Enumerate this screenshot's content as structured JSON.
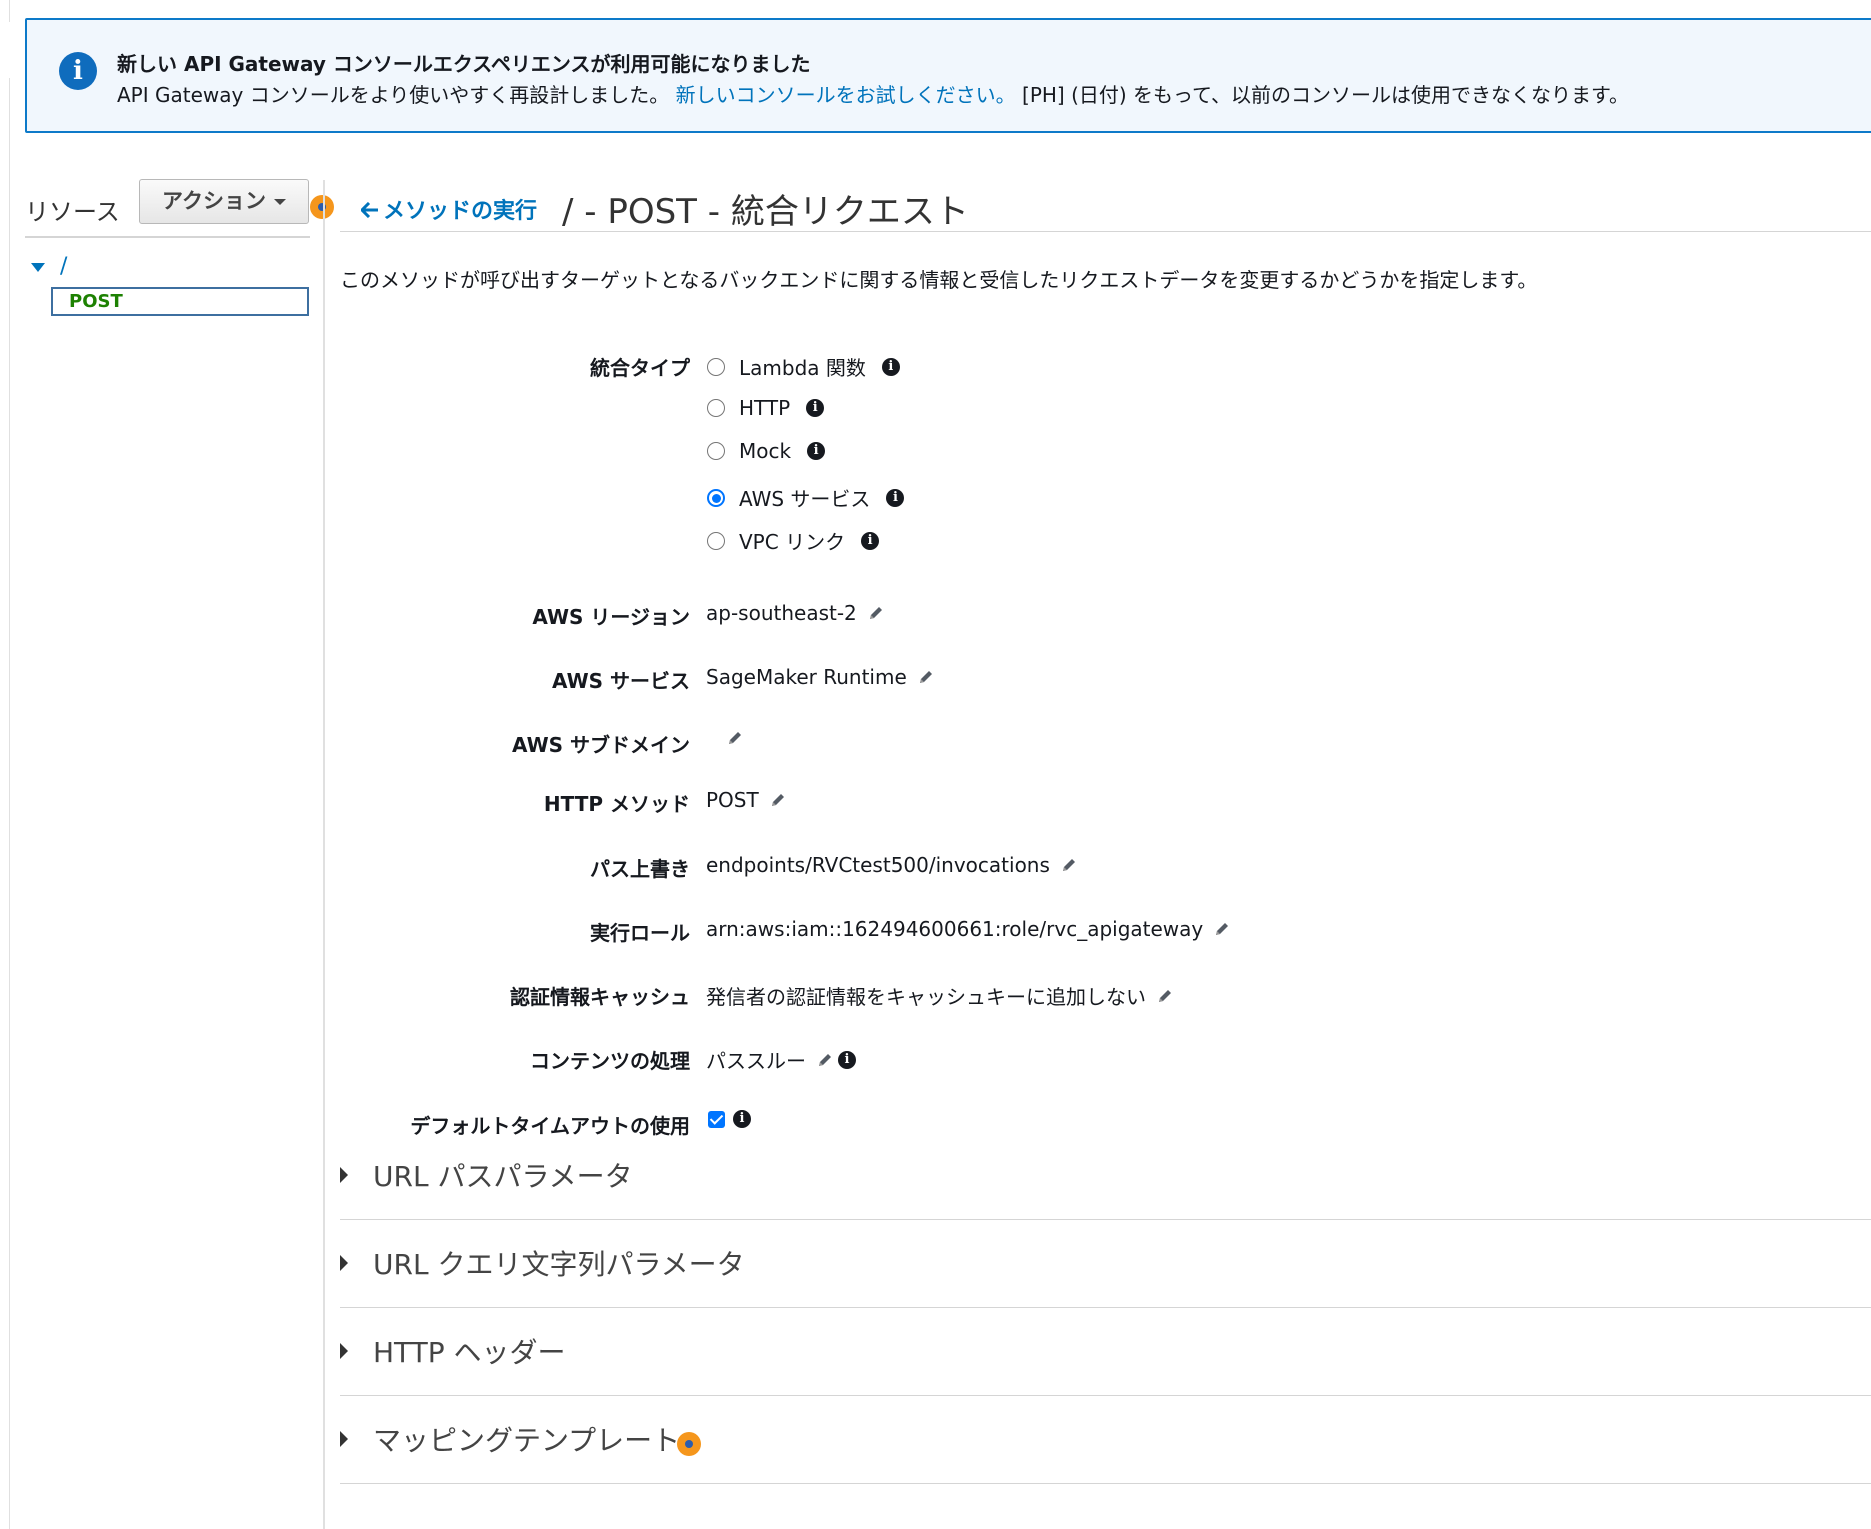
{
  "banner": {
    "icon": "info-icon",
    "title": "新しい API Gateway コンソールエクスペリエンスが利用可能になりました",
    "body_prefix": "API Gateway コンソールをより使いやすく再設計しました。",
    "link": "新しいコンソールをお試しください。",
    "body_suffix": "[PH] (日付) をもって、以前のコンソールは使用できなくなります。"
  },
  "sidebar": {
    "resources_label": "リソース",
    "actions_button": "アクション",
    "tree": {
      "root": "/",
      "selected_method": "POST"
    }
  },
  "header": {
    "back_link": "メソッドの実行",
    "title": "/ - POST - 統合リクエスト",
    "description": "このメソッドが呼び出すターゲットとなるバックエンドに関する情報と受信したリクエストデータを変更するかどうかを指定します。"
  },
  "form": {
    "integration_type": {
      "label": "統合タイプ",
      "options": [
        {
          "label": "Lambda 関数",
          "selected": false
        },
        {
          "label": "HTTP",
          "selected": false
        },
        {
          "label": "Mock",
          "selected": false
        },
        {
          "label": "AWS サービス",
          "selected": true
        },
        {
          "label": "VPC リンク",
          "selected": false
        }
      ]
    },
    "aws_region": {
      "label": "AWS リージョン",
      "value": "ap-southeast-2"
    },
    "aws_service": {
      "label": "AWS サービス",
      "value": "SageMaker Runtime"
    },
    "aws_subdomain": {
      "label": "AWS サブドメイン",
      "value": ""
    },
    "http_method": {
      "label": "HTTP メソッド",
      "value": "POST"
    },
    "path_override": {
      "label": "パス上書き",
      "value": "endpoints/RVCtest500/invocations"
    },
    "execution_role": {
      "label": "実行ロール",
      "value": "arn:aws:iam::162494600661:role/rvc_apigateway"
    },
    "credentials_cache": {
      "label": "認証情報キャッシュ",
      "value": "発信者の認証情報をキャッシュキーに追加しない"
    },
    "content_handling": {
      "label": "コンテンツの処理",
      "value": "パススルー"
    },
    "default_timeout": {
      "label": "デフォルトタイムアウトの使用",
      "checked": true
    }
  },
  "sections": [
    {
      "title": "URL パスパラメータ"
    },
    {
      "title": "URL クエリ文字列パラメータ"
    },
    {
      "title": "HTTP ヘッダー"
    },
    {
      "title": "マッピングテンプレート"
    }
  ],
  "icons": {
    "info": "info-icon",
    "edit": "pencil-icon",
    "expand": "caret-right-icon",
    "back": "arrow-left-icon"
  },
  "colors": {
    "link": "#0073bb",
    "banner_border": "#0d7ac9",
    "banner_bg": "#f1f7fd",
    "method_green": "#1d8102",
    "highlight_orange": "#f5961c",
    "radio_blue": "#0075ff"
  }
}
